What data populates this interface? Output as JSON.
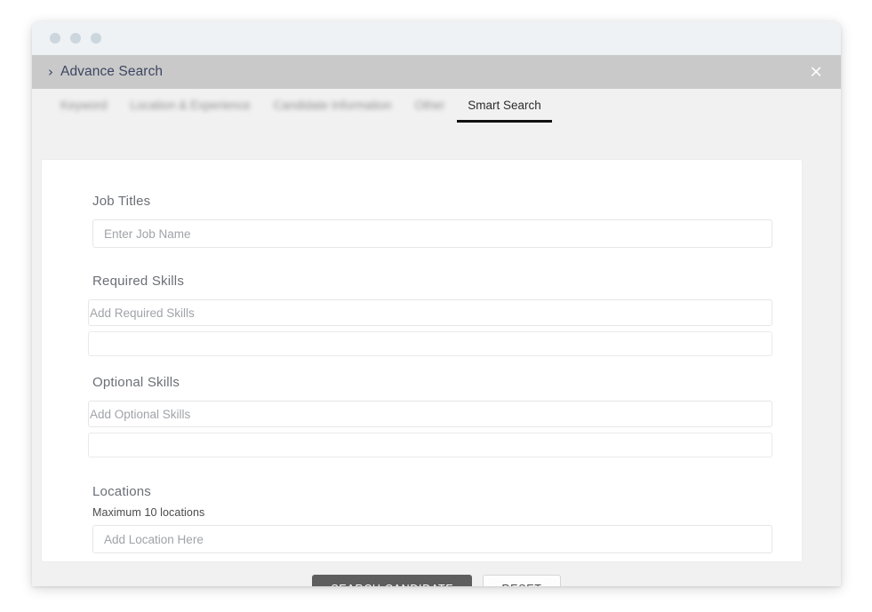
{
  "window": {
    "traffic_lights": [
      "dot-1",
      "dot-2",
      "dot-3"
    ]
  },
  "modal": {
    "chevron_icon": "chevron-right-icon",
    "title": "Advance Search",
    "close_icon": "×"
  },
  "tabs": [
    {
      "label": "Keyword",
      "active": false
    },
    {
      "label": "Location & Experience",
      "active": false
    },
    {
      "label": "Candidate Information",
      "active": false
    },
    {
      "label": "Other",
      "active": false
    },
    {
      "label": "Smart Search",
      "active": true
    }
  ],
  "form": {
    "job_titles": {
      "label": "Job Titles",
      "placeholder": "Enter Job Name",
      "value": ""
    },
    "required_skills": {
      "label": "Required Skills",
      "placeholder": "Add Required Skills",
      "value": "",
      "chips_value": ""
    },
    "optional_skills": {
      "label": "Optional Skills",
      "placeholder": "Add Optional Skills",
      "value": "",
      "chips_value": ""
    },
    "locations": {
      "label": "Locations",
      "helper": "Maximum 10 locations",
      "placeholder": "Add Location Here",
      "value": ""
    }
  },
  "footer": {
    "search_label": "SEARCH CANDIDATE",
    "reset_label": "RESET"
  },
  "colors": {
    "header_bar": "#c9c9c9",
    "titlebar": "#eef2f5",
    "body_bg": "#f1f1f1",
    "card_bg": "#ffffff",
    "primary_button": "#5e5e5e",
    "active_tab_underline": "#111111",
    "dot": "#ccd6dd"
  }
}
